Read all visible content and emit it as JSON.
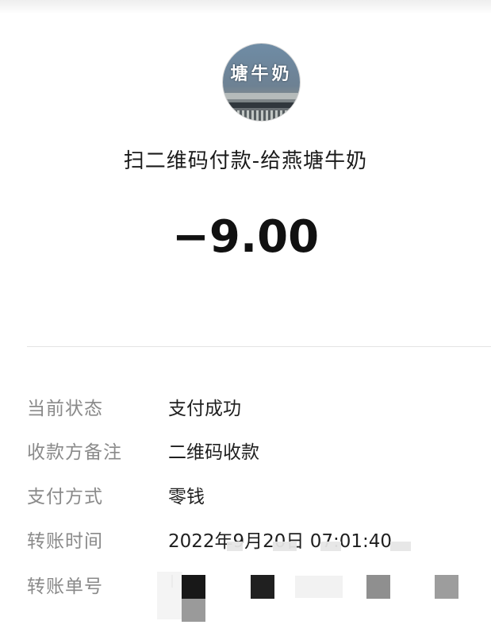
{
  "header": {
    "avatar_text": "塘牛奶",
    "title": "扫二维码付款-给燕塘牛奶"
  },
  "payment": {
    "amount": "−9.00"
  },
  "details": [
    {
      "label": "当前状态",
      "value": "支付成功"
    },
    {
      "label": "收款方备注",
      "value": "二维码收款"
    },
    {
      "label": "支付方式",
      "value": "零钱"
    },
    {
      "label": "转账时间",
      "value": "2022年9月20日 07:01:40"
    },
    {
      "label": "转账单号",
      "value": ""
    }
  ],
  "colors": {
    "label": "#8a8a8a",
    "value": "#1f1f1f",
    "amount": "#111111",
    "divider": "#e4e4e4"
  }
}
